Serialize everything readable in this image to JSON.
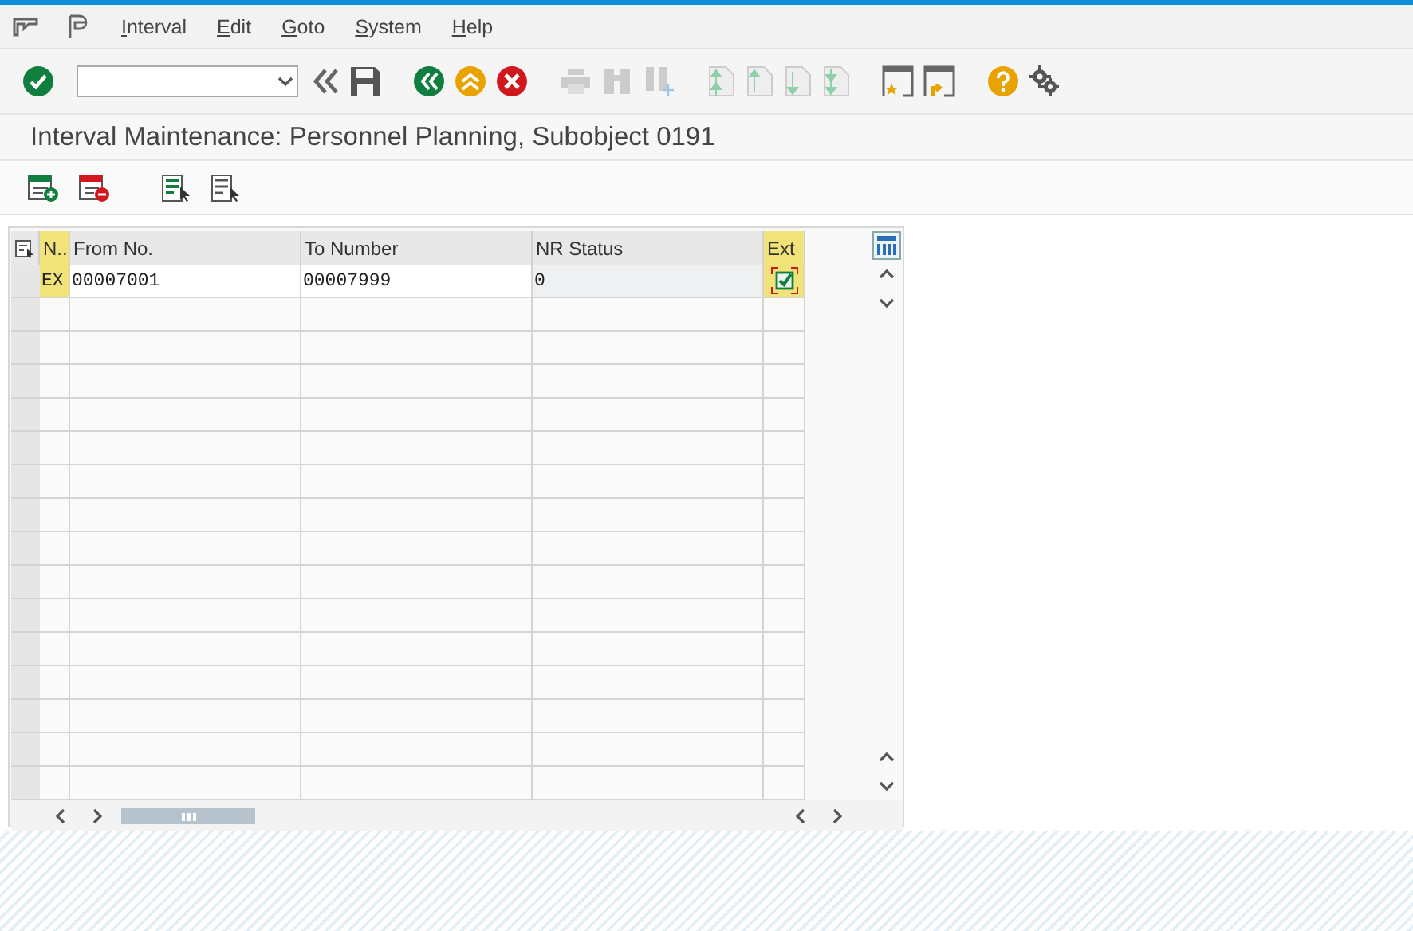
{
  "menu": [
    "Interval",
    "Edit",
    "Goto",
    "System",
    "Help"
  ],
  "title": "Interval Maintenance: Personnel Planning, Subobject 0191",
  "table": {
    "columns": [
      {
        "label": "N..",
        "highlighted": true
      },
      {
        "label": "From No.",
        "highlighted": false
      },
      {
        "label": "To Number",
        "highlighted": false
      },
      {
        "label": "NR Status",
        "highlighted": false
      },
      {
        "label": "Ext",
        "highlighted": true
      }
    ],
    "rows": [
      {
        "cells": [
          "EX",
          "00007001",
          "00007999",
          "0"
        ],
        "ext_checked": true
      }
    ]
  }
}
